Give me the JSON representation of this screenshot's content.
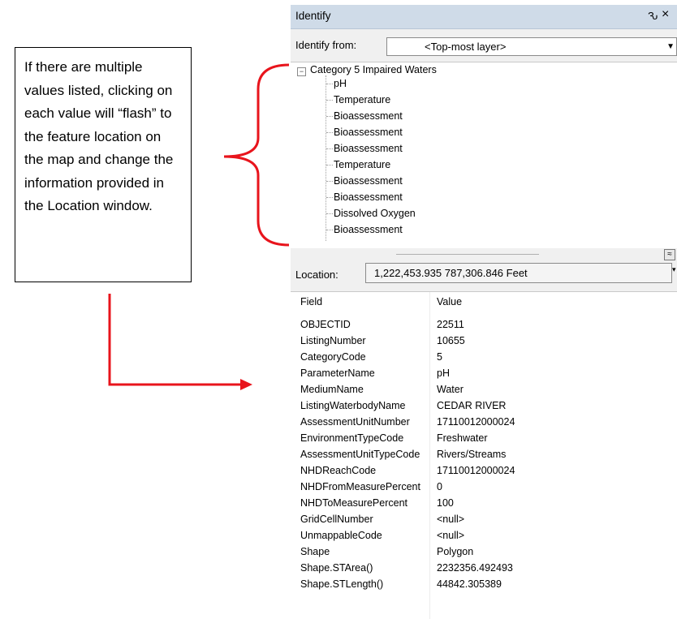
{
  "annotation": {
    "text": "If there are multiple values listed, clicking on each value will “flash” to the feature location on the map and change the information provided in the Location window.",
    "arrow_color": "#e8141c"
  },
  "window": {
    "title": "Identify",
    "pin_glyph": "Ԅ",
    "close_glyph": "×"
  },
  "identify_from": {
    "label": "Identify from:",
    "value": "<Top-most layer>"
  },
  "tree": {
    "root": "Category 5 Impaired Waters",
    "items": [
      "pH",
      "Temperature",
      "Bioassessment",
      "Bioassessment",
      "Bioassessment",
      "Temperature",
      "Bioassessment",
      "Bioassessment",
      "Dissolved Oxygen",
      "Bioassessment"
    ]
  },
  "location": {
    "label": "Location:",
    "value": "1,222,453.935  787,306.846 Feet"
  },
  "attributes": {
    "header": {
      "field": "Field",
      "value": "Value"
    },
    "rows": [
      {
        "field": "OBJECTID",
        "value": "22511"
      },
      {
        "field": "ListingNumber",
        "value": "10655"
      },
      {
        "field": "CategoryCode",
        "value": "5"
      },
      {
        "field": "ParameterName",
        "value": "pH"
      },
      {
        "field": "MediumName",
        "value": "Water"
      },
      {
        "field": "ListingWaterbodyName",
        "value": "CEDAR RIVER"
      },
      {
        "field": "AssessmentUnitNumber",
        "value": "17110012000024"
      },
      {
        "field": "EnvironmentTypeCode",
        "value": "Freshwater"
      },
      {
        "field": "AssessmentUnitTypeCode",
        "value": "Rivers/Streams"
      },
      {
        "field": "NHDReachCode",
        "value": "17110012000024"
      },
      {
        "field": "NHDFromMeasurePercent",
        "value": "0"
      },
      {
        "field": "NHDToMeasurePercent",
        "value": "100"
      },
      {
        "field": "GridCellNumber",
        "value": "<null>"
      },
      {
        "field": "UnmappableCode",
        "value": "<null>"
      },
      {
        "field": "Shape",
        "value": "Polygon"
      },
      {
        "field": "Shape.STArea()",
        "value": "2232356.492493"
      },
      {
        "field": "Shape.STLength()",
        "value": "44842.305389"
      }
    ]
  }
}
